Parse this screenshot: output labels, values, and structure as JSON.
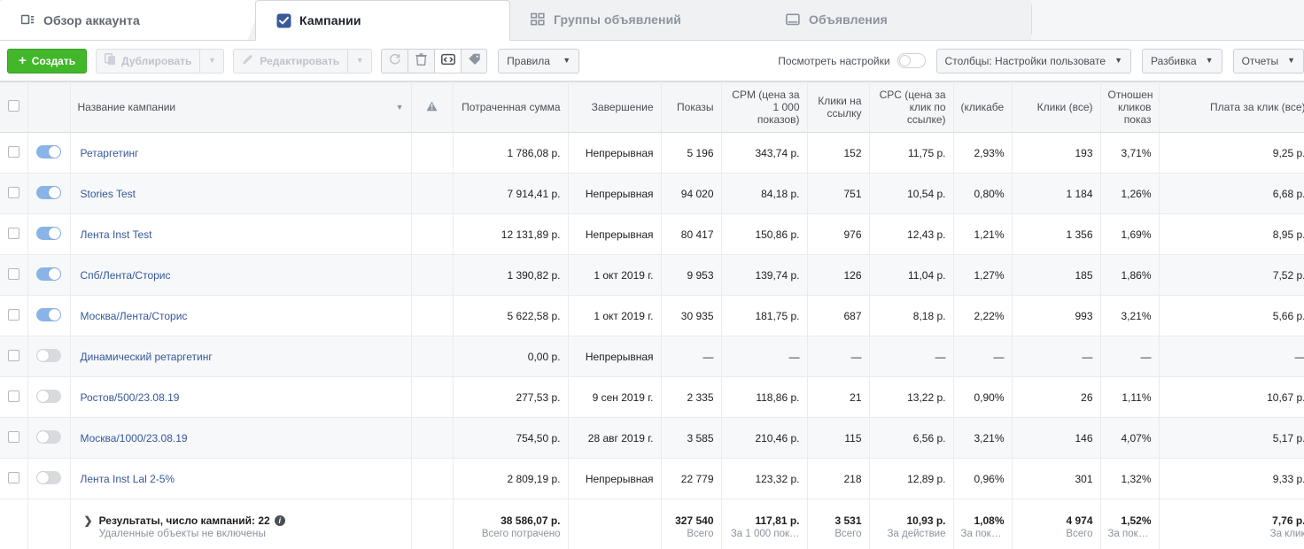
{
  "tabs": [
    {
      "label": "Обзор аккаунта",
      "icon": "account-overview-icon",
      "active": false
    },
    {
      "label": "Кампании",
      "icon": "campaigns-check-icon",
      "active": true
    },
    {
      "label": "Группы объявлений",
      "icon": "adsets-grid-icon",
      "active": false
    },
    {
      "label": "Объявления",
      "icon": "ads-window-icon",
      "active": false
    }
  ],
  "toolbar": {
    "create_label": "Создать",
    "duplicate_label": "Дублировать",
    "edit_label": "Редактировать",
    "rules_label": "Правила",
    "view_settings_label": "Посмотреть настройки",
    "columns_label": "Столбцы: Настройки пользовате",
    "breakdown_label": "Разбивка",
    "reports_label": "Отчеты",
    "icons": [
      "refresh-icon",
      "trash-icon",
      "preview-icon",
      "tag-icon"
    ],
    "accent_green": "#42b72a",
    "accent_blue": "#4080ff"
  },
  "table": {
    "headers": {
      "name": "Название кампании",
      "warn": "",
      "spent": "Потраченная сумма",
      "end": "Завершение",
      "impressions": "Показы",
      "cpm": "CPM (цена за 1 000 показов)",
      "link_clicks": "Клики на ссылку",
      "cpc": "CPC (цена за клик по ссылке)",
      "ctr": "(кликабе",
      "clicks_all": "Клики (все)",
      "ctr_all": "Отношен кликов показ",
      "cpc_all": "Плата за клик (все)"
    },
    "rows": [
      {
        "name": "Ретаргетинг",
        "on": true,
        "spent": "1 786,08 р.",
        "end": "Непрерывная",
        "impressions": "5 196",
        "cpm": "343,74 р.",
        "link_clicks": "152",
        "cpc": "11,75 р.",
        "ctr": "2,93%",
        "clicks_all": "193",
        "ctr_all": "3,71%",
        "cpc_all": "9,25 р."
      },
      {
        "name": "Stories Test",
        "on": true,
        "spent": "7 914,41 р.",
        "end": "Непрерывная",
        "impressions": "94 020",
        "cpm": "84,18 р.",
        "link_clicks": "751",
        "cpc": "10,54 р.",
        "ctr": "0,80%",
        "clicks_all": "1 184",
        "ctr_all": "1,26%",
        "cpc_all": "6,68 р."
      },
      {
        "name": "Лента Inst Test",
        "on": true,
        "spent": "12 131,89 р.",
        "end": "Непрерывная",
        "impressions": "80 417",
        "cpm": "150,86 р.",
        "link_clicks": "976",
        "cpc": "12,43 р.",
        "ctr": "1,21%",
        "clicks_all": "1 356",
        "ctr_all": "1,69%",
        "cpc_all": "8,95 р."
      },
      {
        "name": "Спб/Лента/Сторис",
        "on": true,
        "spent": "1 390,82 р.",
        "end": "1 окт 2019 г.",
        "impressions": "9 953",
        "cpm": "139,74 р.",
        "link_clicks": "126",
        "cpc": "11,04 р.",
        "ctr": "1,27%",
        "clicks_all": "185",
        "ctr_all": "1,86%",
        "cpc_all": "7,52 р."
      },
      {
        "name": "Москва/Лента/Сторис",
        "on": true,
        "spent": "5 622,58 р.",
        "end": "1 окт 2019 г.",
        "impressions": "30 935",
        "cpm": "181,75 р.",
        "link_clicks": "687",
        "cpc": "8,18 р.",
        "ctr": "2,22%",
        "clicks_all": "993",
        "ctr_all": "3,21%",
        "cpc_all": "5,66 р."
      },
      {
        "name": "Динамический ретаргетинг",
        "on": false,
        "spent": "0,00 р.",
        "end": "Непрерывная",
        "impressions": "—",
        "cpm": "—",
        "link_clicks": "—",
        "cpc": "—",
        "ctr": "—",
        "clicks_all": "—",
        "ctr_all": "—",
        "cpc_all": "—"
      },
      {
        "name": "Ростов/500/23.08.19",
        "on": false,
        "spent": "277,53 р.",
        "end": "9 сен 2019 г.",
        "impressions": "2 335",
        "cpm": "118,86 р.",
        "link_clicks": "21",
        "cpc": "13,22 р.",
        "ctr": "0,90%",
        "clicks_all": "26",
        "ctr_all": "1,11%",
        "cpc_all": "10,67 р."
      },
      {
        "name": "Москва/1000/23.08.19",
        "on": false,
        "spent": "754,50 р.",
        "end": "28 авг 2019 г.",
        "impressions": "3 585",
        "cpm": "210,46 р.",
        "link_clicks": "115",
        "cpc": "6,56 р.",
        "ctr": "3,21%",
        "clicks_all": "146",
        "ctr_all": "4,07%",
        "cpc_all": "5,17 р."
      },
      {
        "name": "Лента Inst Lal 2-5%",
        "on": false,
        "spent": "2 809,19 р.",
        "end": "Непрерывная",
        "impressions": "22 779",
        "cpm": "123,32 р.",
        "link_clicks": "218",
        "cpc": "12,89 р.",
        "ctr": "0,96%",
        "clicks_all": "301",
        "ctr_all": "1,32%",
        "cpc_all": "9,33 р."
      }
    ],
    "summary": {
      "title": "Результаты, число кампаний: 22",
      "subtitle": "Удаленные объекты не включены",
      "spent": "38 586,07 р.",
      "spent_sub": "Всего потрачено",
      "impressions": "327 540",
      "impressions_sub": "Всего",
      "cpm": "117,81 р.",
      "cpm_sub": "За 1 000 пок…",
      "link_clicks": "3 531",
      "link_clicks_sub": "Всего",
      "cpc": "10,93 р.",
      "cpc_sub": "За действие",
      "ctr": "1,08%",
      "ctr_sub": "За показы",
      "clicks_all": "4 974",
      "clicks_all_sub": "Всего",
      "ctr_all": "1,52%",
      "ctr_all_sub": "За показы",
      "cpc_all": "7,76 р.",
      "cpc_all_sub": "За клик"
    }
  }
}
